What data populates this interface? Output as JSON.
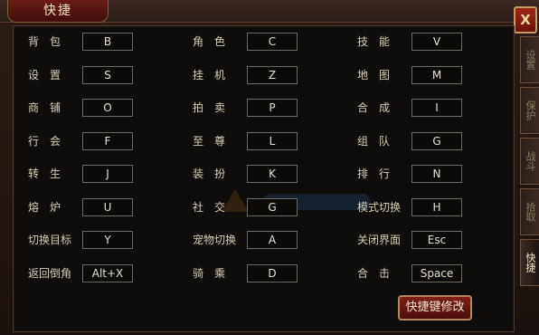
{
  "window": {
    "title": "快捷",
    "close_label": "X",
    "modify_button_label": "快捷键修改"
  },
  "side_tabs": [
    {
      "label": "设置",
      "active": false
    },
    {
      "label": "保护",
      "active": false
    },
    {
      "label": "战斗",
      "active": false
    },
    {
      "label": "拾取",
      "active": false
    },
    {
      "label": "快捷",
      "active": true
    }
  ],
  "shortcuts": [
    [
      {
        "label": "背　包",
        "key": "B"
      },
      {
        "label": "角　色",
        "key": "C"
      },
      {
        "label": "技　能",
        "key": "V"
      }
    ],
    [
      {
        "label": "设　置",
        "key": "S"
      },
      {
        "label": "挂　机",
        "key": "Z"
      },
      {
        "label": "地　图",
        "key": "M"
      }
    ],
    [
      {
        "label": "商　铺",
        "key": "O"
      },
      {
        "label": "拍　卖",
        "key": "P"
      },
      {
        "label": "合　成",
        "key": "I"
      }
    ],
    [
      {
        "label": "行　会",
        "key": "F"
      },
      {
        "label": "至　尊",
        "key": "L"
      },
      {
        "label": "组　队",
        "key": "G"
      }
    ],
    [
      {
        "label": "转　生",
        "key": "J"
      },
      {
        "label": "装　扮",
        "key": "K"
      },
      {
        "label": "排　行",
        "key": "N"
      }
    ],
    [
      {
        "label": "熔　炉",
        "key": "U"
      },
      {
        "label": "社　交",
        "key": "G"
      },
      {
        "label": "模式切换",
        "key": "H"
      }
    ],
    [
      {
        "label": "切换目标",
        "key": "Y"
      },
      {
        "label": "宠物切换",
        "key": "A"
      },
      {
        "label": "关闭界面",
        "key": "Esc"
      }
    ],
    [
      {
        "label": "返回倒角",
        "key": "Alt+X"
      },
      {
        "label": "骑　乘",
        "key": "D"
      },
      {
        "label": "合　击",
        "key": "Space"
      }
    ]
  ]
}
